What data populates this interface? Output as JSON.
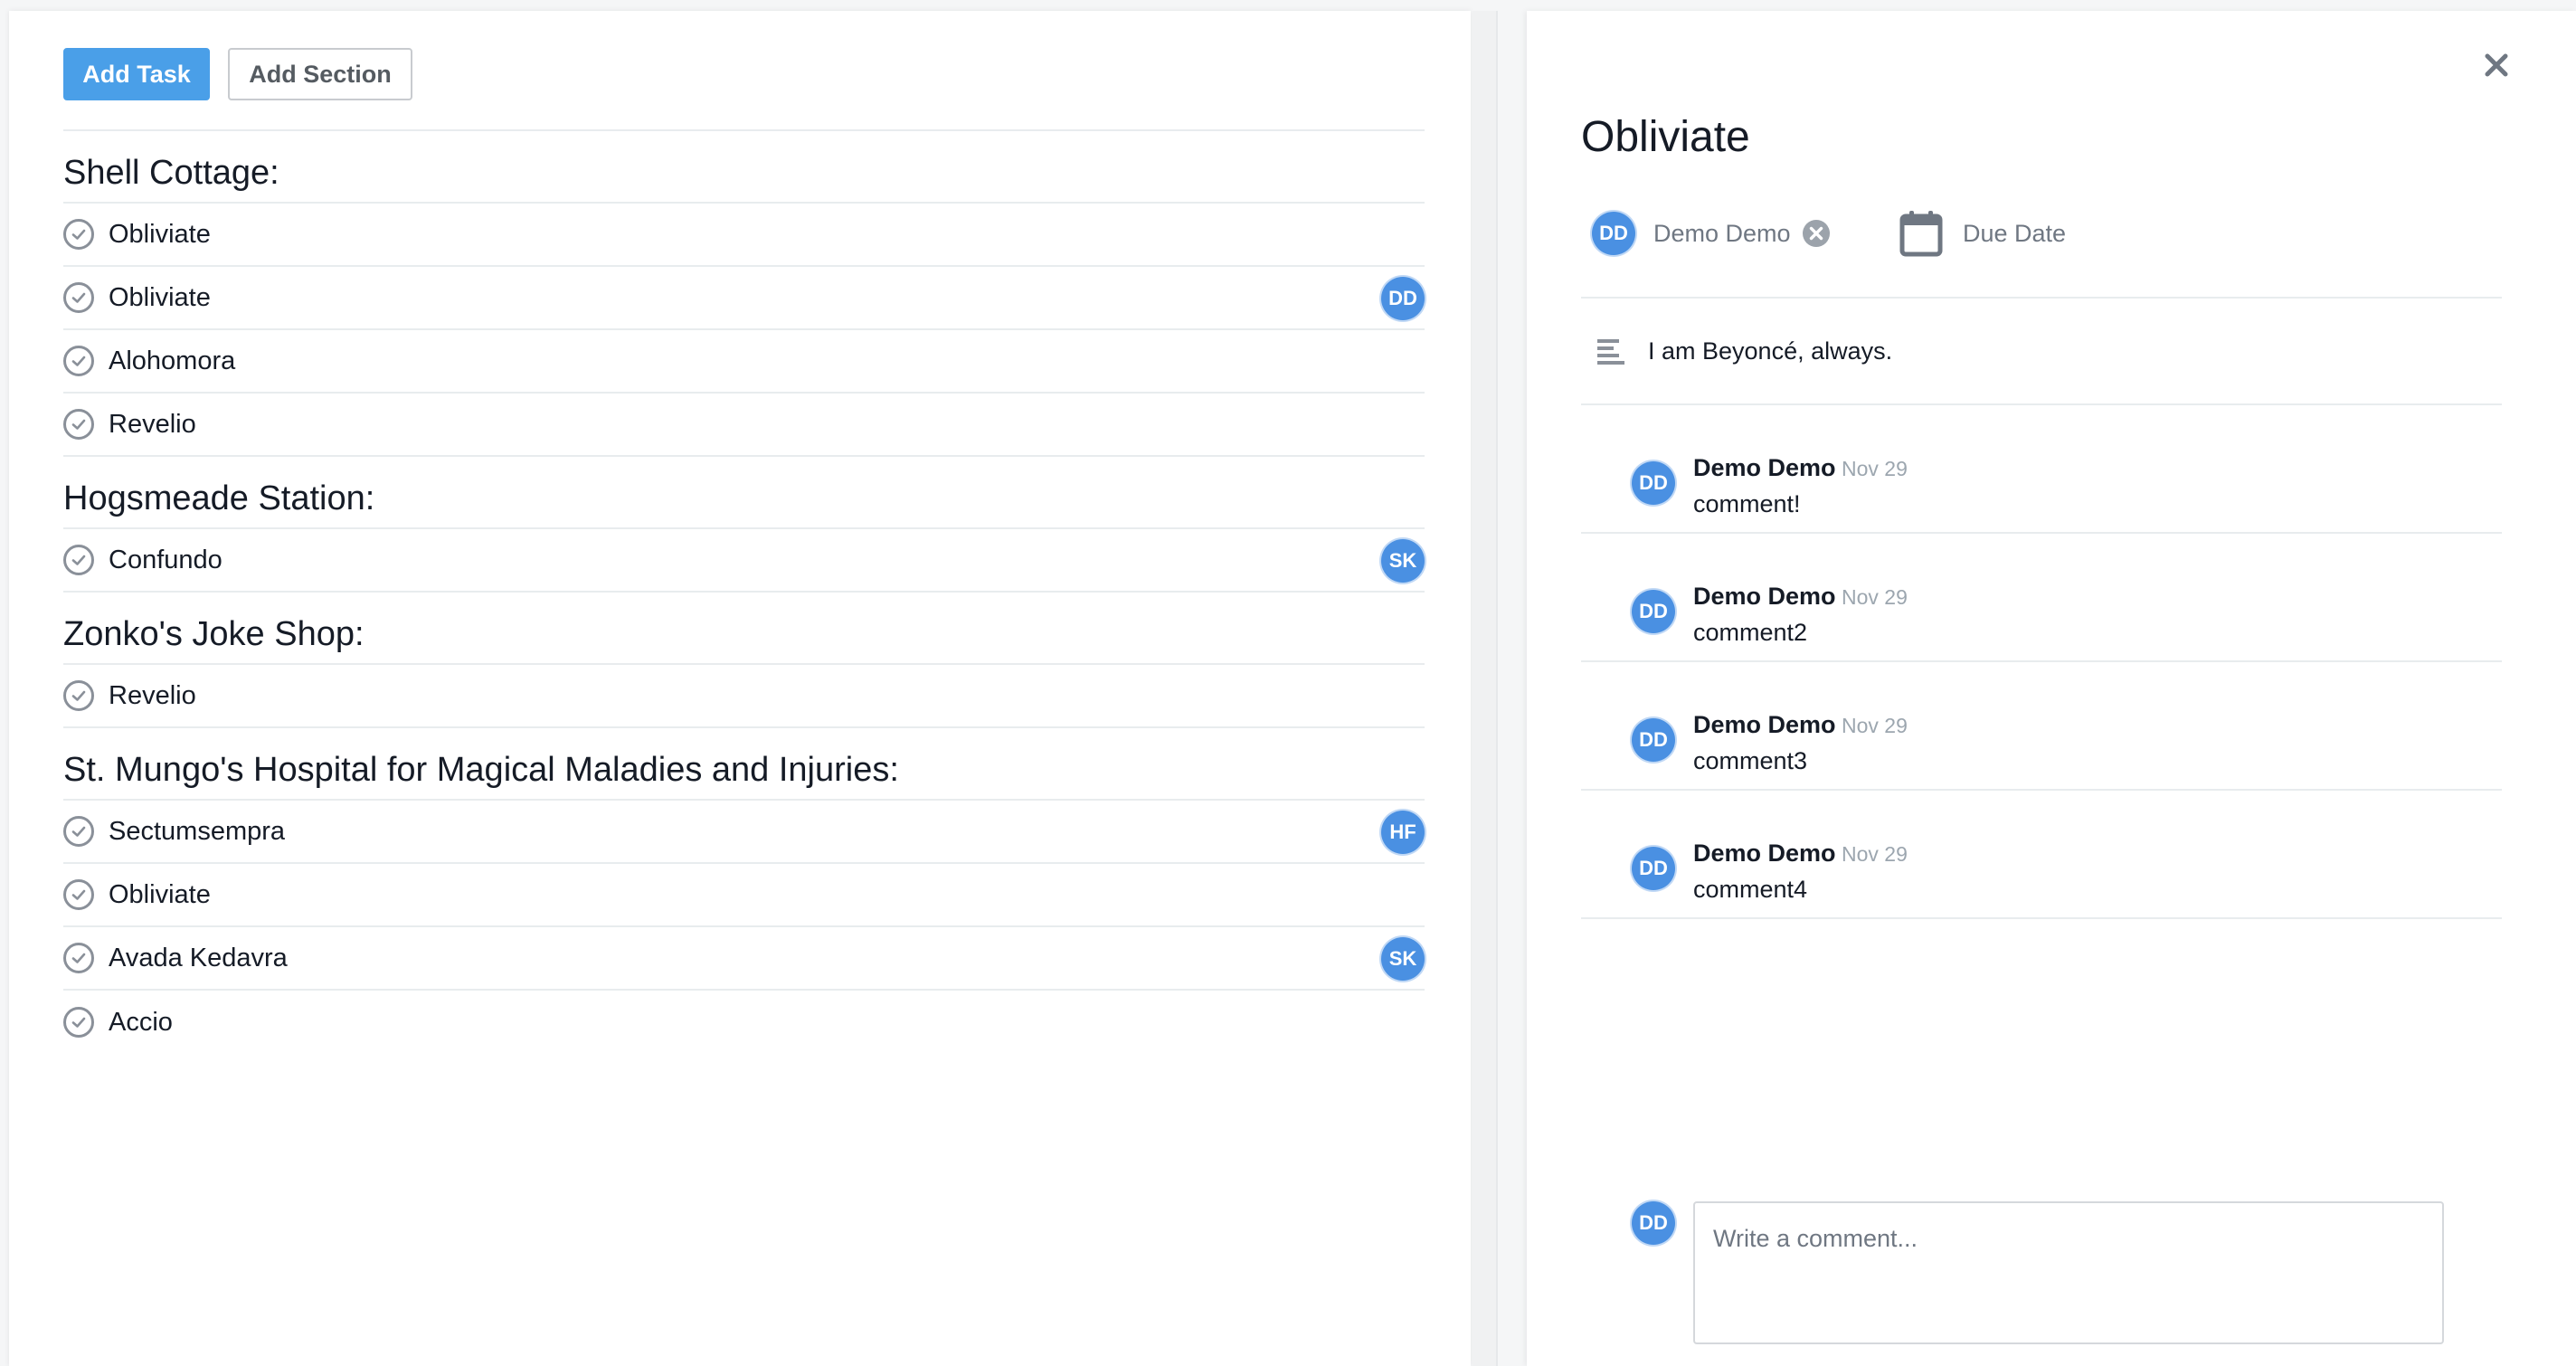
{
  "toolbar": {
    "add_task_label": "Add Task",
    "add_section_label": "Add Section"
  },
  "sections": [
    {
      "title": "Shell Cottage:",
      "tasks": [
        {
          "name": "Obliviate",
          "assignee": ""
        },
        {
          "name": "Obliviate",
          "assignee": "DD"
        },
        {
          "name": "Alohomora",
          "assignee": ""
        },
        {
          "name": "Revelio",
          "assignee": ""
        }
      ]
    },
    {
      "title": "Hogsmeade Station:",
      "tasks": [
        {
          "name": "Confundo",
          "assignee": "SK"
        }
      ]
    },
    {
      "title": "Zonko's Joke Shop:",
      "tasks": [
        {
          "name": "Revelio",
          "assignee": ""
        }
      ]
    },
    {
      "title": "St. Mungo's Hospital for Magical Maladies and Injuries:",
      "tasks": [
        {
          "name": "Sectumsempra",
          "assignee": "HF"
        },
        {
          "name": "Obliviate",
          "assignee": ""
        },
        {
          "name": "Avada Kedavra",
          "assignee": "SK"
        },
        {
          "name": "Accio",
          "assignee": ""
        }
      ]
    }
  ],
  "detail": {
    "title": "Obliviate",
    "assignee_initials": "DD",
    "assignee_name": "Demo Demo",
    "due_date_label": "Due Date",
    "description": "I am Beyoncé, always.",
    "comments": [
      {
        "initials": "DD",
        "author": "Demo Demo",
        "date": "Nov 29",
        "text": "comment!"
      },
      {
        "initials": "DD",
        "author": "Demo Demo",
        "date": "Nov 29",
        "text": "comment2"
      },
      {
        "initials": "DD",
        "author": "Demo Demo",
        "date": "Nov 29",
        "text": "comment3"
      },
      {
        "initials": "DD",
        "author": "Demo Demo",
        "date": "Nov 29",
        "text": "comment4"
      }
    ],
    "composer_initials": "DD",
    "comment_placeholder": "Write a comment..."
  },
  "colors": {
    "primary": "#4a9fe8",
    "avatar": "#4a90e2",
    "divider": "#e8ecee",
    "muted_text": "#6f7782"
  }
}
